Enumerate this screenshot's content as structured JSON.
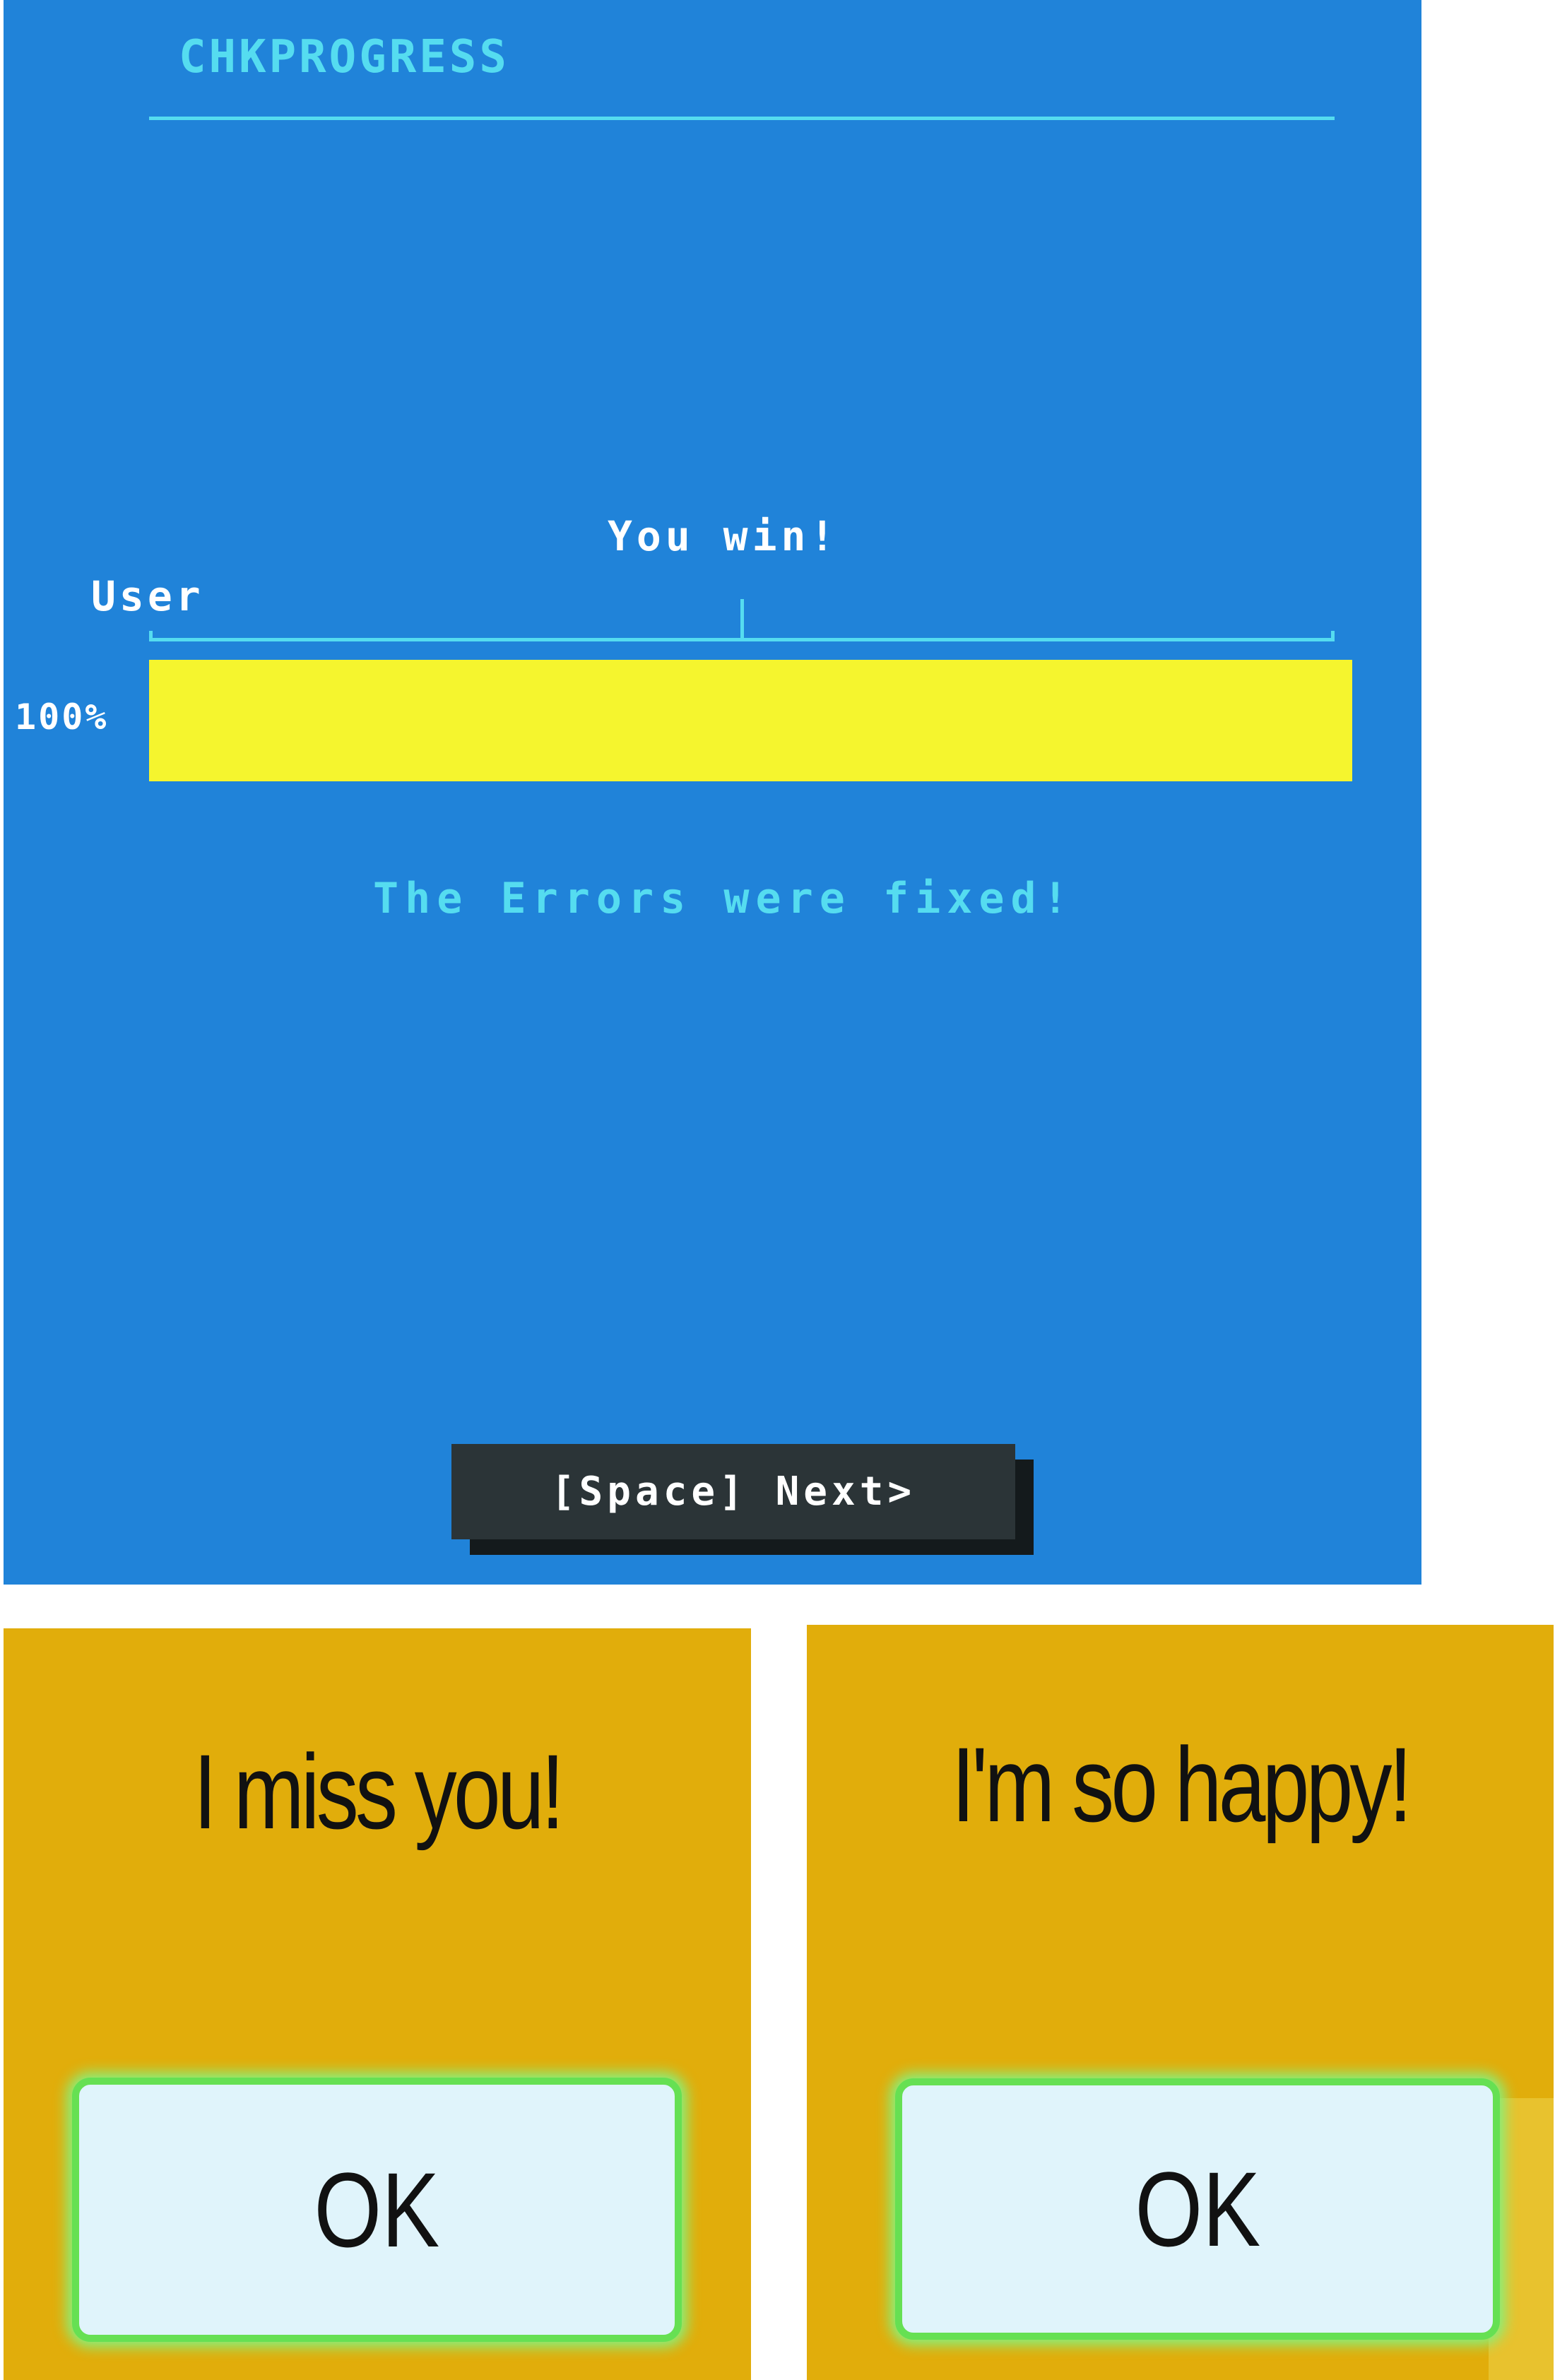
{
  "screen": {
    "title": "CHKPROGRESS",
    "status_message": "You win!",
    "user_label": "User",
    "progress": {
      "label": "100%",
      "value": 1.0,
      "track_marker": 0.5
    },
    "result_message": "The Errors were fixed!",
    "next_button_label": "[Space] Next>",
    "colors": {
      "background": "#2083d9",
      "accent": "#55dcf0",
      "progress_fill": "#f5f52e",
      "button": "#2b3437"
    }
  },
  "dialogs": [
    {
      "message": "I miss you!",
      "button_label": "OK"
    },
    {
      "message": "I'm so happy!",
      "button_label": "OK"
    }
  ],
  "dialog_colors": {
    "background": "#e1ad0b",
    "button": "#e0f4fb",
    "button_glow": "#66e053"
  }
}
